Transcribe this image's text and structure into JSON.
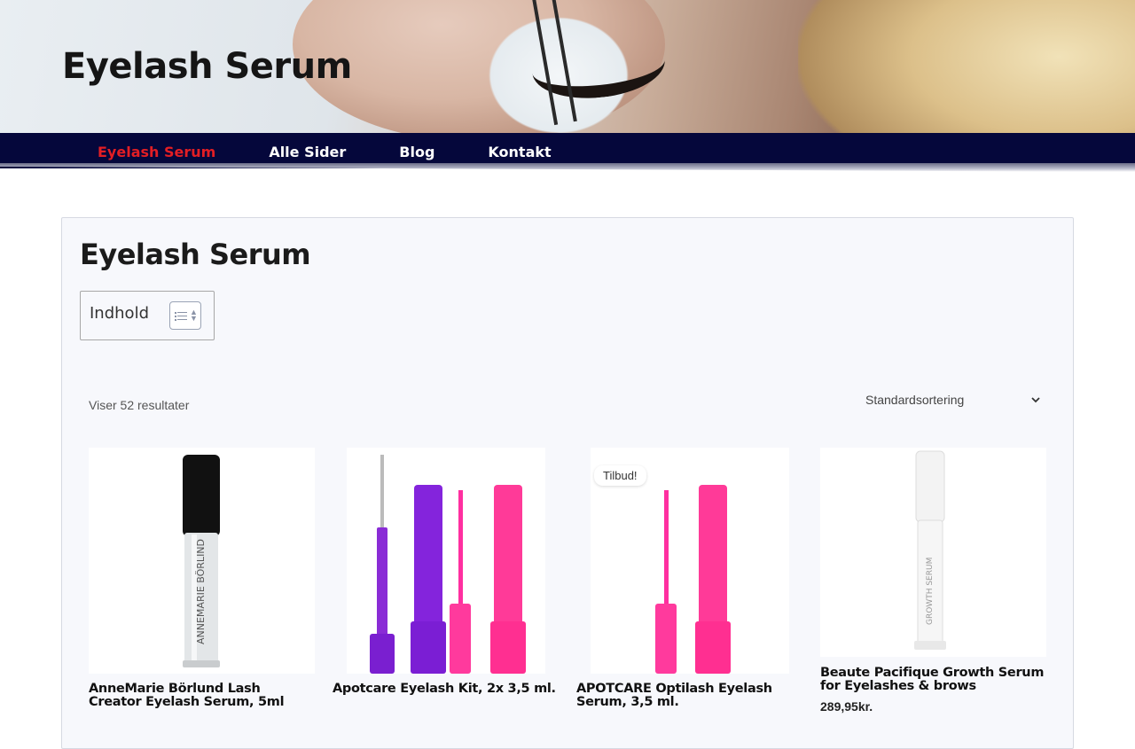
{
  "header": {
    "site_title": "Eyelash Serum"
  },
  "nav": {
    "items": [
      {
        "label": "Eyelash Serum",
        "active": true
      },
      {
        "label": "Alle Sider",
        "active": false
      },
      {
        "label": "Blog",
        "active": false
      },
      {
        "label": "Kontakt",
        "active": false
      }
    ]
  },
  "main": {
    "page_title": "Eyelash Serum",
    "toc_label": "Indhold",
    "result_count": "Viser 52 resultater",
    "sort_selected": "Standardsortering",
    "products": [
      {
        "name": "AnneMarie Börlund Lash Creator Eyelash Serum, 5ml",
        "badge": "",
        "price": ""
      },
      {
        "name": "Apotcare Eyelash Kit, 2x 3,5 ml.",
        "badge": "",
        "price": ""
      },
      {
        "name": "APOTCARE Optilash Eyelash Serum, 3,5 ml.",
        "badge": "Tilbud!",
        "price": ""
      },
      {
        "name": "Beaute Pacifique Growth Serum for Eyelashes & brows",
        "badge": "",
        "price": "289,95kr."
      }
    ]
  },
  "colors": {
    "nav_bg": "#05073b",
    "nav_active": "#e31e24",
    "content_bg": "#f7f8fc"
  }
}
